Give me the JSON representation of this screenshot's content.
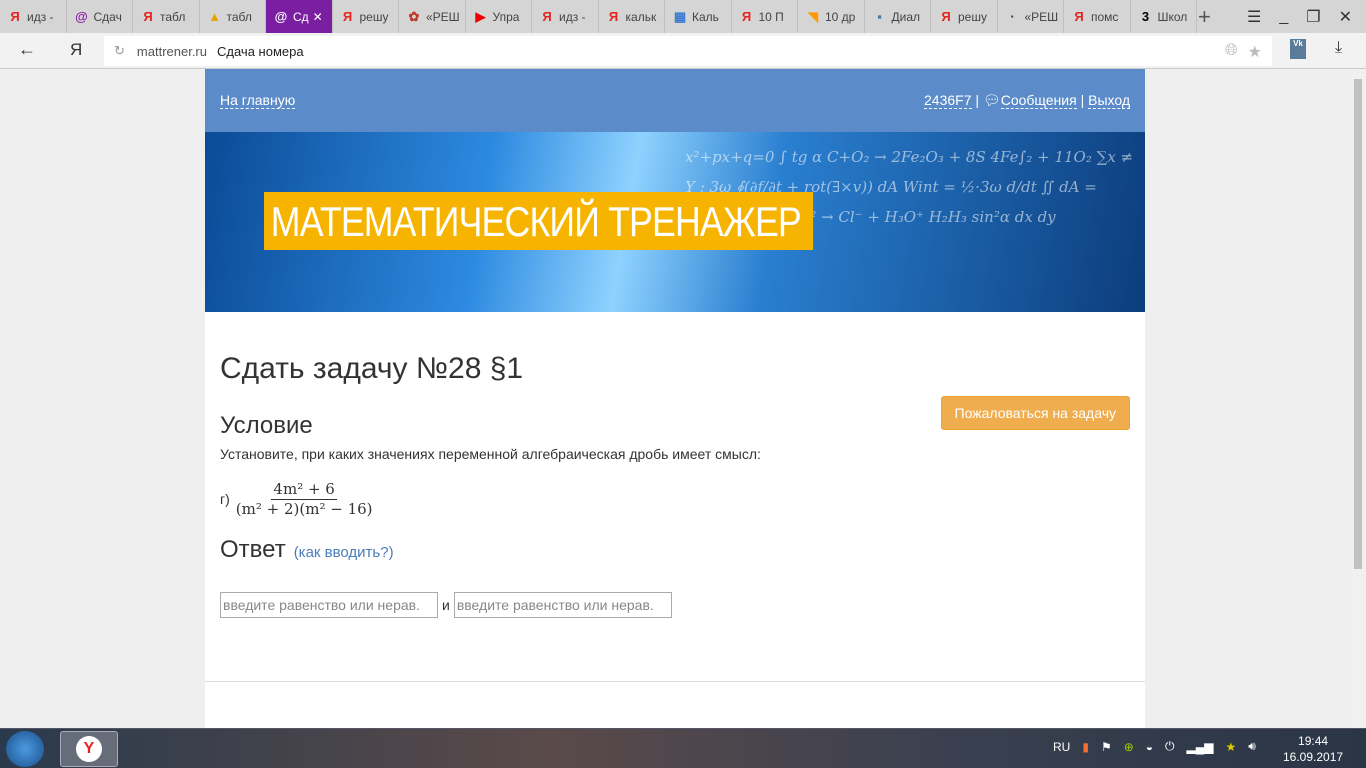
{
  "browser": {
    "tabs": [
      {
        "label": "идз -",
        "icon": "yandex-icon"
      },
      {
        "label": "Сдач",
        "icon": "mattrener-icon"
      },
      {
        "label": "табл",
        "icon": "yandex-icon"
      },
      {
        "label": "табл",
        "icon": "image-icon"
      },
      {
        "label": "Сд",
        "icon": "mattrener-icon",
        "active": true
      },
      {
        "label": "решу",
        "icon": "yandex-icon"
      },
      {
        "label": "«РЕШ",
        "icon": "reshu-icon"
      },
      {
        "label": "Упра",
        "icon": "youtube-icon"
      },
      {
        "label": "идз -",
        "icon": "yandex-icon"
      },
      {
        "label": "кальк",
        "icon": "yandex-icon"
      },
      {
        "label": "Каль",
        "icon": "calculator-icon"
      },
      {
        "label": "10 П",
        "icon": "yandex-icon"
      },
      {
        "label": "10 др",
        "icon": "rss-icon"
      },
      {
        "label": "Диал",
        "icon": "chat-icon"
      },
      {
        "label": "решу",
        "icon": "yandex-icon"
      },
      {
        "label": "«РЕШ",
        "icon": "dot-icon"
      },
      {
        "label": "помс",
        "icon": "yandex-icon"
      },
      {
        "label": "Школ",
        "icon": "znanija-icon"
      }
    ],
    "yandex_logo": "Я",
    "url_domain": "mattrener.ru",
    "url_title": "Сдача номера"
  },
  "nav": {
    "home": "На главную",
    "user": "2436F7",
    "messages": "Сообщения",
    "logout": "Выход",
    "sep": "|"
  },
  "banner": {
    "title": "МАТЕМАТИЧЕСКИЙ ТРЕНАЖЕР",
    "formulas": "x²+px+q=0 ∫ tg α  C+O₂ → 2Fe₂O₃ + 8S  4Fe∫₂ + 11O₂ ∑x ≠ Y ; 3ω  ∮(∂f/∂t + rot(∃×v)) dA  Wint = ½·3ω  d/dt ∬ dA = ∮E'dl  a² = b² + c²  → Cl⁻ + H₃O⁺  H₂H₃ sin²α dx dy"
  },
  "main": {
    "title": "Сдать задачу №28 §1",
    "complain_button": "Пожаловаться на задачу",
    "condition_heading": "Условие",
    "condition_text": "Установите, при каких значениях переменной алгебраическая дробь имеет смысл:",
    "item_label": "г)",
    "numerator": "4m² + 6",
    "denominator": "(m² + 2)(m² − 16)",
    "answer_heading": "Ответ",
    "how_to_enter": "(как вводить?)",
    "input_placeholder": "введите равенство или нерав.",
    "and": "и"
  },
  "taskbar": {
    "lang": "RU",
    "time": "19:44",
    "date": "16.09.2017"
  }
}
